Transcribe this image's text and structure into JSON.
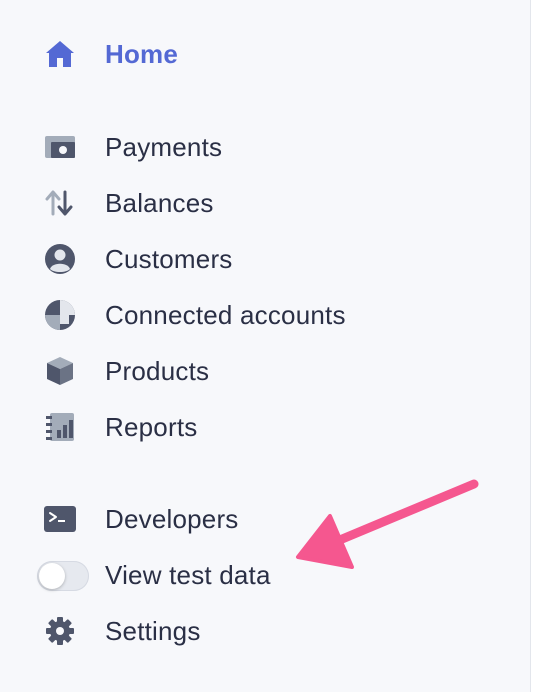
{
  "sidebar": {
    "items": [
      {
        "label": "Home",
        "icon": "home-icon",
        "active": true
      },
      {
        "label": "Payments",
        "icon": "payments-icon"
      },
      {
        "label": "Balances",
        "icon": "balances-icon"
      },
      {
        "label": "Customers",
        "icon": "customers-icon"
      },
      {
        "label": "Connected accounts",
        "icon": "connected-accounts-icon"
      },
      {
        "label": "Products",
        "icon": "products-icon"
      },
      {
        "label": "Reports",
        "icon": "reports-icon"
      },
      {
        "label": "Developers",
        "icon": "developers-icon"
      },
      {
        "label": "View test data",
        "icon": "toggle-switch",
        "toggle_on": false
      },
      {
        "label": "Settings",
        "icon": "gear-icon"
      }
    ]
  },
  "colors": {
    "active": "#5469d4",
    "text": "#2a2f45",
    "icon": "#4f566b",
    "annotation_arrow": "#f5578f"
  }
}
